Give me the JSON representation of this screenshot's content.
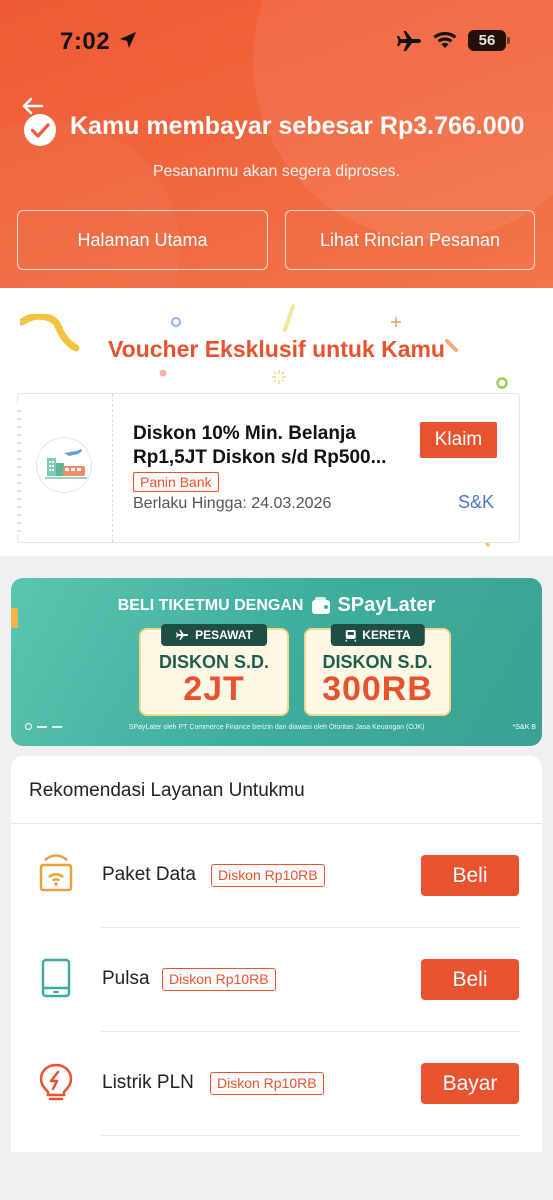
{
  "status_bar": {
    "time": "7:02",
    "battery": "56"
  },
  "header": {
    "title": "Kamu membayar sebesar Rp3.766.000",
    "subtitle": "Pesananmu akan segera diproses.",
    "home_button": "Halaman Utama",
    "detail_button": "Lihat Rincian Pesanan"
  },
  "voucher": {
    "section_title": "Voucher Eksklusif untuk Kamu",
    "line1": "Diskon 10% Min. Belanja",
    "line2": "Rp1,5JT Diskon s/d Rp500...",
    "bank": "Panin Bank",
    "validity": "Berlaku Hingga: 24.03.2026",
    "claim_label": "Klaim",
    "terms_label": "S&K"
  },
  "banner": {
    "headline": "BELI TIKETMU DENGAN",
    "brand": "SPayLater",
    "plane": {
      "tag": "PESAWAT",
      "line1": "DISKON S.D.",
      "amount": "2JT"
    },
    "train": {
      "tag": "KERETA",
      "line1": "DISKON S.D.",
      "amount": "300RB"
    },
    "footnote": "SPayLater oleh PT Commerce Finance berizin dan diawasi oleh Otoritas Jasa Keuangan (OJK)",
    "sk": "*S&K B"
  },
  "recommendations": {
    "title": "Rekomendasi Layanan Untukmu",
    "items": [
      {
        "label": "Paket Data",
        "badge": "Diskon Rp10RB",
        "action": "Beli",
        "icon": "data-package-icon"
      },
      {
        "label": "Pulsa",
        "badge": "Diskon Rp10RB",
        "action": "Beli",
        "icon": "phone-credit-icon"
      },
      {
        "label": "Listrik PLN",
        "badge": "Diskon Rp10RB",
        "action": "Bayar",
        "icon": "electricity-icon"
      }
    ]
  },
  "colors": {
    "accent": "#e8522f",
    "header_bg": "#ef5a35",
    "banner_bg": "#3fae9c",
    "link": "#4a78c9"
  }
}
